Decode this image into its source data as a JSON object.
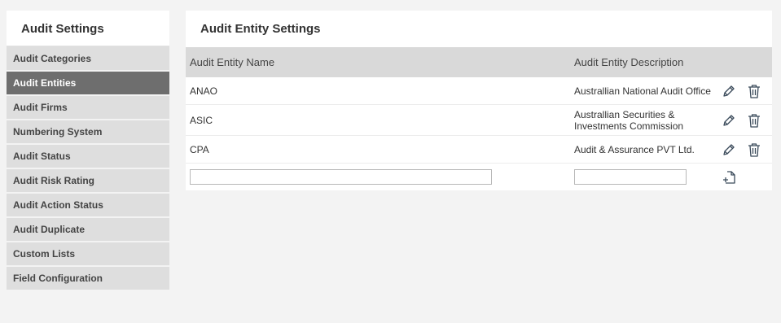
{
  "sidebar": {
    "title": "Audit Settings",
    "items": [
      {
        "label": "Audit Categories"
      },
      {
        "label": "Audit Entities"
      },
      {
        "label": "Audit Firms"
      },
      {
        "label": "Numbering System"
      },
      {
        "label": "Audit Status"
      },
      {
        "label": "Audit Risk Rating"
      },
      {
        "label": "Audit Action Status"
      },
      {
        "label": "Audit Duplicate"
      },
      {
        "label": "Custom Lists"
      },
      {
        "label": "Field Configuration"
      }
    ],
    "active_index": 1
  },
  "main": {
    "title": "Audit Entity Settings",
    "columns": {
      "name": "Audit Entity Name",
      "description": "Audit Entity Description"
    },
    "rows": [
      {
        "name": "ANAO",
        "description": "Australlian National Audit Office"
      },
      {
        "name": "ASIC",
        "description": "Australlian Securities & Investments Commission"
      },
      {
        "name": "CPA",
        "description": "Audit & Assurance PVT Ltd."
      }
    ],
    "new_row": {
      "name_value": "",
      "description_value": ""
    }
  },
  "colors": {
    "background": "#f3f3f3",
    "sidebar_item": "#dedede",
    "sidebar_active": "#6e6e6e",
    "table_header": "#d9d9d9",
    "icon": "#3a4a5a"
  },
  "icons": {
    "edit": "pencil-icon",
    "delete": "trash-icon",
    "add": "add-file-icon"
  }
}
